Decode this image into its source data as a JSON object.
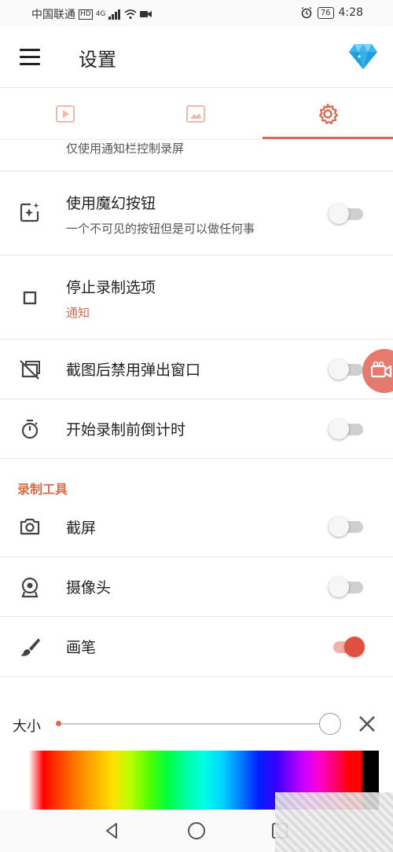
{
  "status_bar": {
    "carrier": "中国联通",
    "network": "4G",
    "battery": "76",
    "time": "4:28"
  },
  "app_bar": {
    "title": "设置"
  },
  "tabs": [
    {
      "icon": "video-play-icon",
      "active": false
    },
    {
      "icon": "image-icon",
      "active": false
    },
    {
      "icon": "gear-icon",
      "active": true
    }
  ],
  "settings": {
    "partial_row_subtitle": "仅使用通知栏控制录屏",
    "magic_button": {
      "title": "使用魔幻按钮",
      "subtitle": "一个不可见的按钮但是可以做任何事",
      "enabled": false
    },
    "stop_options": {
      "title": "停止录制选项",
      "value": "通知"
    },
    "disable_popup": {
      "title": "截图后禁用弹出窗口",
      "enabled": false
    },
    "countdown": {
      "title": "开始录制前倒计时",
      "enabled": false
    }
  },
  "tools_section": {
    "header": "录制工具",
    "screenshot": {
      "title": "截屏",
      "enabled": false
    },
    "camera": {
      "title": "摄像头",
      "enabled": false
    },
    "brush": {
      "title": "画笔",
      "enabled": true
    }
  },
  "brush_panel": {
    "size_label": "大小",
    "size_value": 1.0
  },
  "colors": {
    "accent": "#d96a4c",
    "toggle_on": "#e0503f",
    "fab": "#e57a6f"
  }
}
